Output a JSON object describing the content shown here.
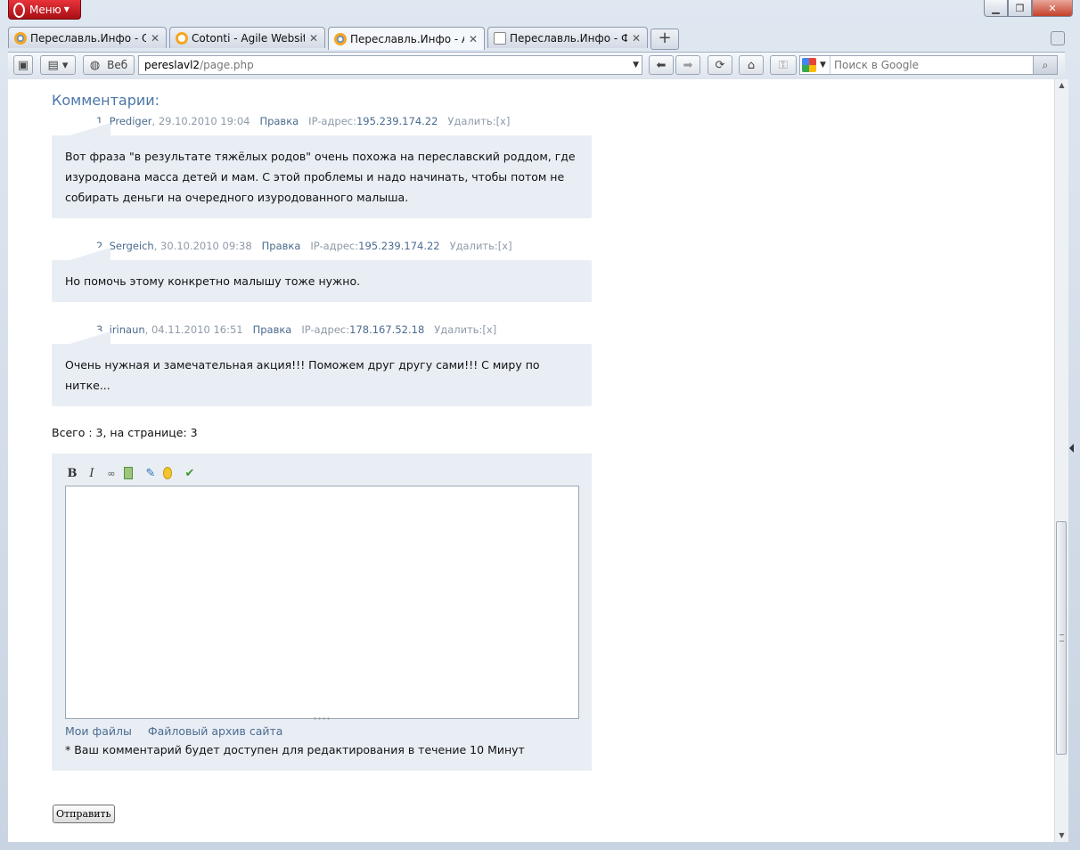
{
  "menu": {
    "label": "Меню"
  },
  "tabs": [
    {
      "title": "Переславль.Инфо - О...",
      "icon": "opera-icon"
    },
    {
      "title": "Cotonti - Agile Websit...",
      "icon": "cotonti-icon"
    },
    {
      "title": "Переславль.Инфо - А...",
      "icon": "opera-icon",
      "active": true
    },
    {
      "title": "Переславль.Инфо - Ф...",
      "icon": "ne-icon"
    }
  ],
  "toolbar": {
    "web_label": "Веб",
    "address_host": "pereslavl2",
    "address_path": "/page.php",
    "search_placeholder": "Поиск в Google"
  },
  "page": {
    "section_title": "Комментарии:",
    "comments": [
      {
        "num_author": "1. Prediger",
        "date": ", 29.10.2010 19:04",
        "edit": "Правка",
        "ip_label": "IP-адрес:",
        "ip": "195.239.174.22",
        "delete": "Удалить:[x]",
        "text": "Вот фраза \"в результате тяжёлых родов\" очень похожа на переславский роддом, где изуродована масса детей и мам. С этой проблемы и надо начинать, чтобы потом не собирать деньги на очередного изуродованного малыша."
      },
      {
        "num_author": "2. Sergeich",
        "date": ", 30.10.2010 09:38",
        "edit": "Правка",
        "ip_label": "IP-адрес:",
        "ip": "195.239.174.22",
        "delete": "Удалить:[x]",
        "text": "Но помочь этому конкретно малышу тоже нужно."
      },
      {
        "num_author": "3. irinaun",
        "date": ", 04.11.2010 16:51",
        "edit": "Правка",
        "ip_label": "IP-адрес:",
        "ip": "178.167.52.18",
        "delete": "Удалить:[x]",
        "text": "Очень нужная и замечательная акция!!! Поможем друг другу сами!!! С миру по нитке..."
      }
    ],
    "total": "Всего : 3, на странице: 3",
    "editor": {
      "bold": "B",
      "italic": "I",
      "my_files": "Мои файлы",
      "file_archive": "Файловый архив сайта",
      "note": "* Ваш комментарий будет доступен для редактирования в течение 10 Минут"
    },
    "submit": "Отправить"
  }
}
